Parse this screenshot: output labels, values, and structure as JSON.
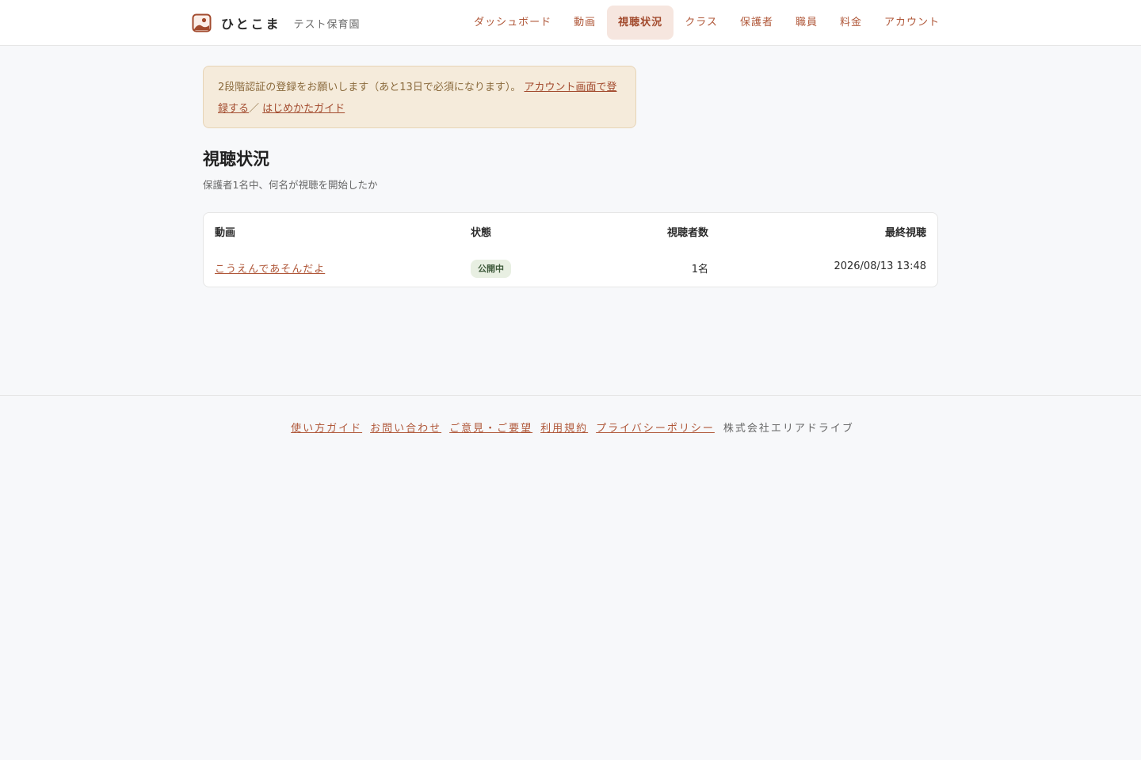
{
  "brand": {
    "name": "ひとこま",
    "org": "テスト保育園",
    "logo_icon": "photo-frame-icon"
  },
  "nav": {
    "items": [
      {
        "label": "ダッシュボード",
        "active": false
      },
      {
        "label": "動画",
        "active": false
      },
      {
        "label": "視聴状況",
        "active": true
      },
      {
        "label": "クラス",
        "active": false
      },
      {
        "label": "保護者",
        "active": false
      },
      {
        "label": "職員",
        "active": false
      },
      {
        "label": "料金",
        "active": false
      },
      {
        "label": "アカウント",
        "active": false
      }
    ]
  },
  "notice": {
    "text": "2段階認証の登録をお願いします（あと13日で必須になります）。",
    "account_link": "アカウント画面で登録する",
    "separator": "／",
    "guide_link": "はじめかたガイド"
  },
  "page": {
    "title": "視聴状況",
    "subtitle": "保護者1名中、何名が視聴を開始したか"
  },
  "table": {
    "headers": {
      "video": "動画",
      "status": "状態",
      "viewers": "視聴者数",
      "last_viewed": "最終視聴"
    },
    "rows": [
      {
        "video": "こうえんであそんだよ",
        "status": "公開中",
        "viewers": "1名",
        "last_viewed": "2026/08/13 13:48"
      }
    ]
  },
  "footer": {
    "links": [
      "使い方ガイド",
      "お問い合わせ",
      "ご意見・ご要望",
      "利用規約",
      "プライバシーポリシー"
    ],
    "company": "株式会社エリアドライブ"
  },
  "colors": {
    "accent": "#b0583a",
    "active_nav_bg": "#f6e6df",
    "notice_bg": "#f5ebdb",
    "badge_bg": "#e8efe2"
  }
}
